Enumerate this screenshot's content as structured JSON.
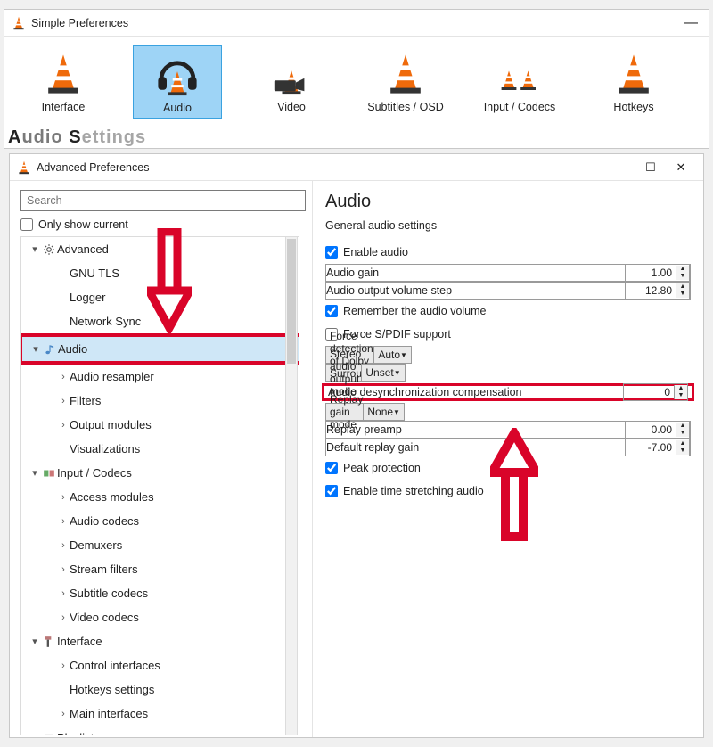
{
  "simple": {
    "title": "Simple Preferences",
    "tabs": [
      {
        "label": "Interface",
        "icon": "cone",
        "selected": false
      },
      {
        "label": "Audio",
        "icon": "headphones-cone",
        "selected": true
      },
      {
        "label": "Video",
        "icon": "video-cone",
        "selected": false
      },
      {
        "label": "Subtitles / OSD",
        "icon": "cone",
        "selected": false
      },
      {
        "label": "Input / Codecs",
        "icon": "cones-pair",
        "selected": false
      },
      {
        "label": "Hotkeys",
        "icon": "cone",
        "selected": false
      }
    ],
    "partial_footer": "Audio Settings"
  },
  "advanced": {
    "title": "Advanced Preferences",
    "search_placeholder": "Search",
    "only_current_label": "Only show current",
    "tree": [
      {
        "label": "Advanced",
        "depth": 0,
        "expander": "down",
        "icon": "gear"
      },
      {
        "label": "GNU TLS",
        "depth": 1
      },
      {
        "label": "Logger",
        "depth": 1
      },
      {
        "label": "Network Sync",
        "depth": 1
      },
      {
        "label": "Audio",
        "depth": 0,
        "expander": "down",
        "icon": "note",
        "selected": true,
        "red_box": true
      },
      {
        "label": "Audio resampler",
        "depth": 1,
        "expander": "right"
      },
      {
        "label": "Filters",
        "depth": 1,
        "expander": "right"
      },
      {
        "label": "Output modules",
        "depth": 1,
        "expander": "right"
      },
      {
        "label": "Visualizations",
        "depth": 1
      },
      {
        "label": "Input / Codecs",
        "depth": 0,
        "expander": "down",
        "icon": "codec"
      },
      {
        "label": "Access modules",
        "depth": 1,
        "expander": "right"
      },
      {
        "label": "Audio codecs",
        "depth": 1,
        "expander": "right"
      },
      {
        "label": "Demuxers",
        "depth": 1,
        "expander": "right"
      },
      {
        "label": "Stream filters",
        "depth": 1,
        "expander": "right"
      },
      {
        "label": "Subtitle codecs",
        "depth": 1,
        "expander": "right"
      },
      {
        "label": "Video codecs",
        "depth": 1,
        "expander": "right"
      },
      {
        "label": "Interface",
        "depth": 0,
        "expander": "down",
        "icon": "brush"
      },
      {
        "label": "Control interfaces",
        "depth": 1,
        "expander": "right"
      },
      {
        "label": "Hotkeys settings",
        "depth": 1
      },
      {
        "label": "Main interfaces",
        "depth": 1,
        "expander": "right"
      },
      {
        "label": "Playlist",
        "depth": 0,
        "expander": "down",
        "icon": "list"
      }
    ],
    "panel": {
      "title": "Audio",
      "subtitle": "General audio settings",
      "rows": [
        {
          "kind": "check",
          "label": "Enable audio",
          "checked": true
        },
        {
          "kind": "spinner",
          "label": "Audio gain",
          "value": "1.00"
        },
        {
          "kind": "spinner",
          "label": "Audio output volume step",
          "value": "12.80"
        },
        {
          "kind": "check",
          "label": "Remember the audio volume",
          "checked": true
        },
        {
          "kind": "check",
          "label": "Force S/PDIF support",
          "checked": false
        },
        {
          "kind": "combo",
          "label": "Force detection of Dolby Surround",
          "value": "Auto"
        },
        {
          "kind": "combo",
          "label": "Stereo audio output mode",
          "value": "Unset"
        },
        {
          "kind": "spinner",
          "label": "Audio desynchronization compensation",
          "value": "0",
          "red_box": true
        },
        {
          "kind": "combo",
          "label": "Replay gain mode",
          "value": "None"
        },
        {
          "kind": "spinner",
          "label": "Replay preamp",
          "value": "0.00"
        },
        {
          "kind": "spinner",
          "label": "Default replay gain",
          "value": "-7.00"
        },
        {
          "kind": "check",
          "label": "Peak protection",
          "checked": true
        },
        {
          "kind": "check",
          "label": "Enable time stretching audio",
          "checked": true
        }
      ]
    }
  }
}
